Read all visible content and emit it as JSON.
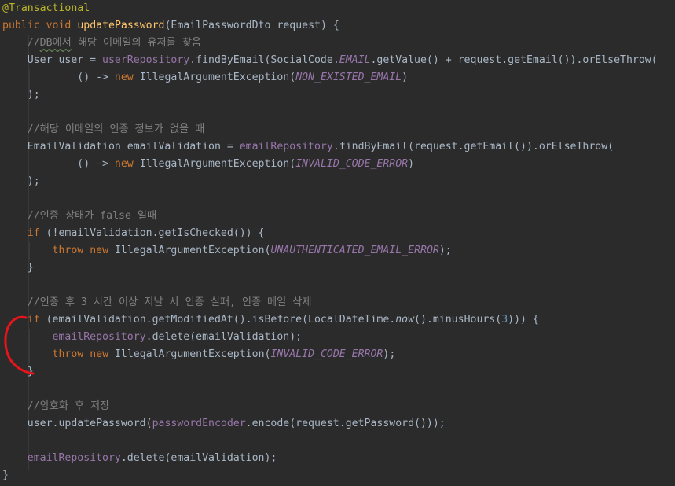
{
  "editor": {
    "language": "java",
    "colors": {
      "background": "#2b2b2b",
      "default_text": "#a9b7c6",
      "keyword": "#cc7832",
      "annotation": "#bbb529",
      "method_decl": "#ffc66d",
      "comment": "#808080",
      "field": "#9876aa",
      "number": "#6897bb",
      "highlight_marker": "#e8141b"
    },
    "lines": {
      "l1": {
        "annotation": "@Transactional"
      },
      "l2": {
        "kw1": "public",
        "kw2": "void",
        "name": "updatePassword",
        "rest": "(EmailPasswordDto request) {"
      },
      "l3": {
        "comment_prefix": "//",
        "comment_underlined": "DB에서",
        "comment_rest": " 해당 이메일의 유저를 찾음"
      },
      "l4": {
        "t1": "User user = ",
        "field1": "userRepository",
        "t2": ".findByEmail(SocialCode.",
        "const1": "EMAIL",
        "t3": ".getValue() + request.getEmail()).orElseThrow("
      },
      "l5": {
        "t1": "() -> ",
        "kw": "new",
        "t2": " IllegalArgumentException(",
        "const": "NON_EXISTED_EMAIL",
        "t3": ")"
      },
      "l6": {
        "text": ");"
      },
      "l8": {
        "comment": "//해당 이메일의 인증 정보가 없을 때"
      },
      "l9": {
        "t1": "EmailValidation emailValidation = ",
        "field": "emailRepository",
        "t2": ".findByEmail(request.getEmail()).orElseThrow("
      },
      "l10": {
        "t1": "() -> ",
        "kw": "new",
        "t2": " IllegalArgumentException(",
        "const": "INVALID_CODE_ERROR",
        "t3": ")"
      },
      "l11": {
        "text": ");"
      },
      "l13": {
        "comment": "//인증 상태가 false 일때"
      },
      "l14": {
        "kw": "if",
        "t1": " (!emailValidation.getIsChecked()) {"
      },
      "l15": {
        "kw1": "throw",
        "kw2": "new",
        "t1": " IllegalArgumentException(",
        "const": "UNAUTHENTICATED_EMAIL_ERROR",
        "t2": ");"
      },
      "l16": {
        "text": "}"
      },
      "l18": {
        "comment": "//인증 후 3 시간 이상 지날 시 인증 실패, 인증 메일 삭제"
      },
      "l19": {
        "kw": "if",
        "t1": " (emailValidation.getModifiedAt().isBefore(LocalDateTime.",
        "static_call": "now",
        "t2": "().minusHours(",
        "num": "3",
        "t3": "))) {"
      },
      "l20": {
        "field": "emailRepository",
        "t1": ".delete(emailValidation);"
      },
      "l21": {
        "kw1": "throw",
        "kw2": "new",
        "t1": " IllegalArgumentException(",
        "const": "INVALID_CODE_ERROR",
        "t2": ");"
      },
      "l22": {
        "text": "}"
      },
      "l24": {
        "comment": "//암호화 후 저장"
      },
      "l25": {
        "t1": "user.updatePassword(",
        "field": "passwordEncoder",
        "t2": ".encode(request.getPassword()));"
      },
      "l27": {
        "field": "emailRepository",
        "t1": ".delete(emailValidation);"
      },
      "l28": {
        "text": "}"
      }
    }
  }
}
